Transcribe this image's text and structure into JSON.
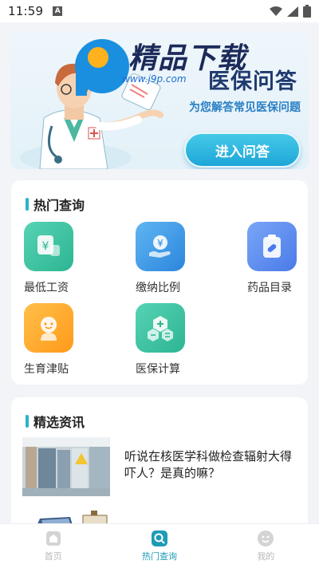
{
  "status_bar": {
    "time": "11:59",
    "notification_letter": "A"
  },
  "banner": {
    "watermark_text": "精品下载",
    "watermark_url": "www.j9p.com",
    "title": "医保问答",
    "subtitle": "为您解答常见医保问题",
    "button_label": "进入问答"
  },
  "hot_query": {
    "title": "热门查询",
    "items": [
      {
        "label": "最低工资",
        "icon": "wage-yuan-icon",
        "color": "#3ec4a4"
      },
      {
        "label": "缴纳比例",
        "icon": "yuan-hand-icon",
        "color": "#3a9de8"
      },
      {
        "label": "药品目录",
        "icon": "medicine-clipboard-icon",
        "color": "#5a8ff0"
      },
      {
        "label": "生育津贴",
        "icon": "baby-icon",
        "color": "#ffa82c"
      },
      {
        "label": "医保计算",
        "icon": "calculator-icon",
        "color": "#3ec4a4"
      }
    ]
  },
  "news": {
    "title": "精选资讯",
    "items": [
      {
        "text": "听说在核医学科做检查辐射大得吓人？是真的嘛？"
      }
    ]
  },
  "bottom_nav": {
    "items": [
      {
        "label": "首页",
        "icon": "home-icon",
        "active": false
      },
      {
        "label": "热门查询",
        "icon": "search-icon",
        "active": true
      },
      {
        "label": "我的",
        "icon": "profile-icon",
        "active": false
      }
    ]
  }
}
